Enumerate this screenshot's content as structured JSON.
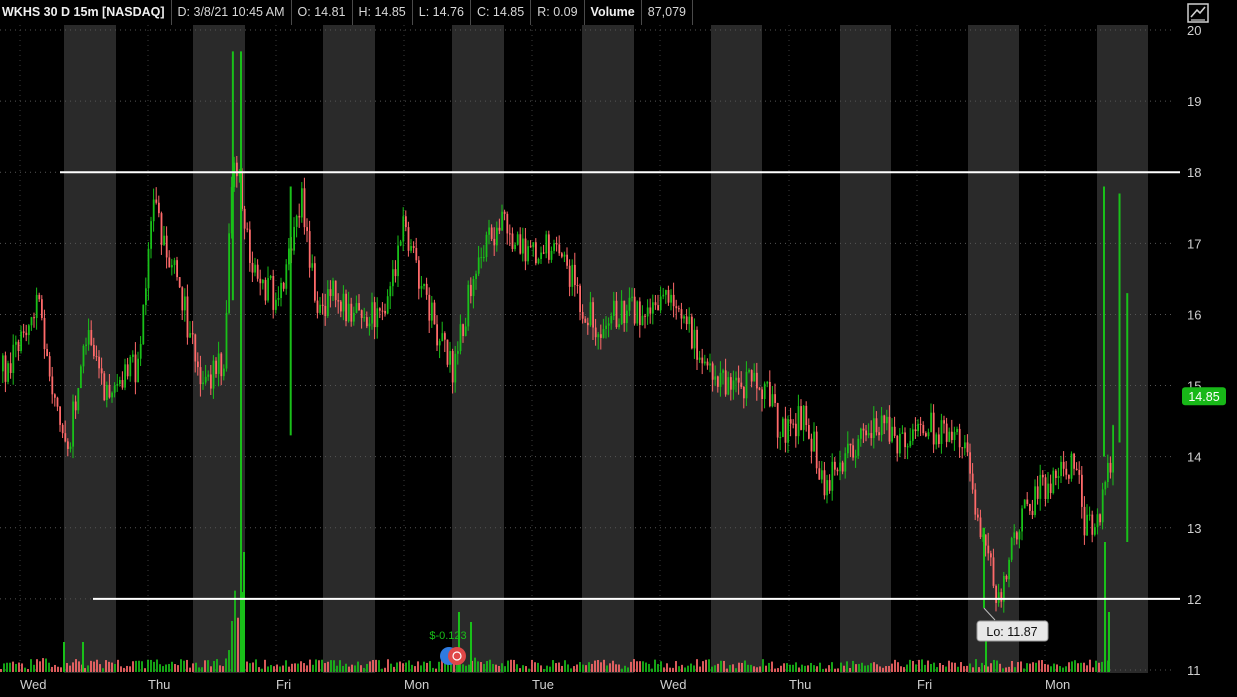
{
  "header": {
    "symbol": "WKHS 30 D 15m [NASDAQ]",
    "date": "D: 3/8/21 10:45 AM",
    "open": "O: 14.81",
    "high": "H: 14.85",
    "low": "L: 14.76",
    "close": "C: 14.85",
    "range": "R: 0.09",
    "volume_label": "Volume",
    "volume_value": "87,079"
  },
  "colors": {
    "background": "#000000",
    "band": "#2a2a2a",
    "up": "#19c019",
    "down": "#ff6a6a",
    "level_line": "#ffffff",
    "price_badge": "#18b818",
    "grid": "#555555"
  },
  "icons": {
    "settings": "style-settings-icon",
    "event_markers": "earnings-event-icon"
  },
  "chart_data": {
    "type": "candlestick",
    "symbol": "WKHS",
    "interval": "15m",
    "ylim": [
      11,
      20
    ],
    "yticks": [
      11,
      12,
      13,
      14,
      15,
      16,
      17,
      18,
      19,
      20
    ],
    "x_labels": [
      "Wed",
      "Thu",
      "Fri",
      "Mon",
      "Tue",
      "Wed",
      "Thu",
      "Fri",
      "Mon"
    ],
    "last_price": "14.85",
    "low_annotation": "Lo: 11.87",
    "event_label": "$-0.123",
    "horizontal_levels": [
      18,
      12
    ],
    "grid": true,
    "path": [
      [
        0.0,
        15.2
      ],
      [
        0.45,
        16.2
      ],
      [
        0.9,
        14.0
      ],
      [
        1.2,
        15.7
      ],
      [
        1.5,
        14.8
      ],
      [
        2.0,
        15.3
      ],
      [
        2.25,
        17.5
      ],
      [
        2.6,
        16.6
      ],
      [
        3.0,
        15.0
      ],
      [
        3.35,
        15.4
      ],
      [
        3.5,
        18.4
      ],
      [
        3.8,
        16.6
      ],
      [
        4.2,
        16.2
      ],
      [
        4.55,
        17.7
      ],
      [
        4.8,
        16.1
      ],
      [
        5.1,
        16.3
      ],
      [
        5.45,
        15.9
      ],
      [
        5.9,
        16.1
      ],
      [
        6.15,
        17.3
      ],
      [
        6.5,
        16.2
      ],
      [
        6.9,
        15.2
      ],
      [
        7.3,
        16.8
      ],
      [
        7.65,
        17.3
      ],
      [
        8.1,
        16.9
      ],
      [
        8.55,
        17.0
      ],
      [
        8.9,
        16.2
      ],
      [
        9.2,
        15.8
      ],
      [
        9.55,
        16.1
      ],
      [
        10.0,
        16.0
      ],
      [
        10.35,
        16.3
      ],
      [
        10.8,
        15.4
      ],
      [
        11.2,
        15.0
      ],
      [
        11.55,
        15.0
      ],
      [
        11.8,
        15.0
      ],
      [
        12.0,
        14.3
      ],
      [
        12.4,
        14.6
      ],
      [
        12.7,
        13.6
      ],
      [
        13.0,
        14.0
      ],
      [
        13.5,
        14.5
      ],
      [
        13.9,
        14.2
      ],
      [
        14.35,
        14.4
      ],
      [
        14.85,
        14.3
      ],
      [
        15.1,
        13.0
      ],
      [
        15.4,
        12.0
      ],
      [
        15.7,
        13.1
      ],
      [
        16.2,
        13.7
      ],
      [
        16.6,
        13.9
      ],
      [
        16.75,
        13.0
      ],
      [
        16.95,
        13.1
      ],
      [
        17.15,
        14.0
      ],
      [
        17.3,
        15.1
      ],
      [
        17.45,
        14.85
      ]
    ],
    "event_spikes": [
      [
        3.5,
        19.7
      ],
      [
        4.4,
        17.8
      ],
      [
        17.3,
        17.7
      ],
      [
        17.42,
        16.3
      ]
    ],
    "volume": [
      [
        0.05,
        0.5
      ],
      [
        0.55,
        0.9
      ],
      [
        1.05,
        0.7
      ],
      [
        2.3,
        0.4
      ],
      [
        3.45,
        1.8
      ],
      [
        3.52,
        6.5
      ],
      [
        4.55,
        0.5
      ],
      [
        6.2,
        0.45
      ],
      [
        6.95,
        1.2
      ],
      [
        7.25,
        0.8
      ],
      [
        9.15,
        0.25
      ],
      [
        11.05,
        0.3
      ],
      [
        12.1,
        0.35
      ],
      [
        13.45,
        0.45
      ],
      [
        15.35,
        0.7
      ],
      [
        16.7,
        0.4
      ],
      [
        17.2,
        1.8
      ],
      [
        17.3,
        1.0
      ]
    ]
  }
}
